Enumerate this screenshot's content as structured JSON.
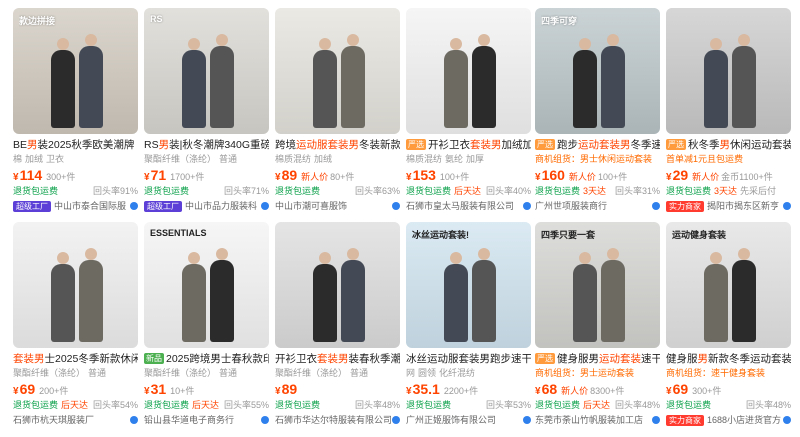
{
  "cards": [
    {
      "title_pre": "BE",
      "title_hl": "男",
      "title_post": "装2025秋季欧美潮牌",
      "tag": "",
      "attrs": [
        "棉",
        "加绒",
        "卫衣"
      ],
      "price": "114",
      "promo": "",
      "sales": "300+件",
      "services": [
        "退货包运费"
      ],
      "rate": "回头率91%",
      "shop_badge": "超级工厂",
      "shop": "中山市泰合国际服",
      "thumb_text": "款边拼接",
      "bg": "#cfc8bd"
    },
    {
      "title_pre": "RS",
      "title_hl": "男",
      "title_post": "装|秋冬潮牌340G重磅",
      "tag": "",
      "attrs": [
        "聚酯纤维（涤纶）",
        "普通"
      ],
      "price": "71",
      "promo": "",
      "sales": "1700+件",
      "services": [
        "退货包运费"
      ],
      "rate": "回头率71%",
      "shop_badge": "超级工厂",
      "shop": "中山市品力服装科",
      "thumb_text": "RS",
      "bg": "#d8d6d0"
    },
    {
      "title_pre": "跨境",
      "title_hl": "运动服套装男",
      "title_post": "冬装新款",
      "tag": "",
      "attrs": [
        "棉质混纺",
        "加绒"
      ],
      "price": "89",
      "promo": "新人价",
      "sales": "80+件",
      "services": [
        "退货包运费"
      ],
      "rate": "回头率63%",
      "shop_badge": "",
      "shop": "中山市潮可喜服饰",
      "thumb_text": "",
      "bg": "#e4e2db"
    },
    {
      "title_pre": "开衫卫衣",
      "title_hl": "套装男",
      "title_post": "加绒加",
      "tag": "严选",
      "attrs": [
        "棉质混纺",
        "氨纶",
        "加厚"
      ],
      "price": "153",
      "promo": "",
      "sales": "100+件",
      "services": [
        "退货包运费",
        "后天达"
      ],
      "rate": "回头率40%",
      "shop_badge": "",
      "shop": "石狮市皇太马服装有限公司",
      "thumb_text": "",
      "bg": "#f2f2f2"
    },
    {
      "title_pre": "跑步",
      "title_hl": "运动套装男",
      "title_post": "冬季速",
      "tag": "严选",
      "attrs_special": "商机组货：男士休闲运动套装",
      "attrs": [],
      "price": "160",
      "promo": "新人价",
      "sales": "100+件",
      "services": [
        "退货包运费",
        "3天达"
      ],
      "rate": "回头率31%",
      "shop_badge": "",
      "shop": "广州世项服装商行",
      "thumb_text": "四季可穿",
      "bg": "#b9c4c7"
    },
    {
      "title_pre": "秋冬季",
      "title_hl": "男",
      "title_post": "休闲运动套装青年",
      "tag": "严选",
      "attrs_special": "首单减1元且包运费",
      "attrs": [],
      "price": "29",
      "promo": "新人价",
      "sales": "金币1100+件",
      "services": [
        "退货包运费",
        "3天达",
        "先采后付"
      ],
      "rate": "",
      "shop_badge": "实力商家",
      "shop": "揭阳市揭东区新亨",
      "thumb_text": "",
      "bg": "#c9c9c9"
    },
    {
      "title_pre": "",
      "title_hl": "套装男",
      "title_post": "士2025冬季新款休闲",
      "tag": "",
      "attrs": [
        "聚酯纤维（涤纶）",
        "普通"
      ],
      "price": "69",
      "promo": "",
      "sales": "200+件",
      "services": [
        "退货包运费",
        "后天达"
      ],
      "rate": "回头率54%",
      "shop_badge": "",
      "shop": "石狮市杭天琪服装厂",
      "thumb_text": "",
      "bg": "#eeeeee"
    },
    {
      "title_pre": "2025跨境男士春秋款印",
      "title_hl": "",
      "title_post": "",
      "tag": "新品",
      "attrs": [
        "聚酯纤维（涤纶）",
        "普通"
      ],
      "price": "31",
      "promo": "",
      "sales": "10+件",
      "services": [
        "退货包运费",
        "后天达"
      ],
      "rate": "回头率55%",
      "shop_badge": "",
      "shop": "铅山县华道电子商务行",
      "thumb_text": "ESSENTIALS",
      "bg": "#f3f3f3"
    },
    {
      "title_pre": "开衫卫衣",
      "title_hl": "套装男",
      "title_post": "装春秋季潮",
      "tag": "",
      "attrs": [
        "聚酯纤维（涤纶）",
        "普通"
      ],
      "price": "89",
      "promo": "",
      "sales": "",
      "services": [
        "退货包运费"
      ],
      "rate": "回头率48%",
      "shop_badge": "",
      "shop": "石狮市华达尔特服装有限公司",
      "thumb_text": "",
      "bg": "#dcdcdc"
    },
    {
      "title_pre": "冰丝运动服套装男跑步速干",
      "title_hl": "",
      "title_post": "",
      "tag": "",
      "attrs": [
        "网",
        "圆领",
        "化纤混纺"
      ],
      "price": "35.1",
      "promo": "",
      "sales": "2200+件",
      "services": [
        "退货包运费"
      ],
      "rate": "回头率53%",
      "shop_badge": "",
      "shop": "广州正姬服饰有限公司",
      "thumb_text": "冰丝运动套装!",
      "bg": "#cfe3ef"
    },
    {
      "title_pre": "健身服男",
      "title_hl": "运动套装",
      "title_post": "速干",
      "tag": "严选",
      "attrs_special": "商机组货：男士运动套装",
      "attrs": [],
      "price": "68",
      "promo": "新人价",
      "sales": "8300+件",
      "services": [
        "退货包运费",
        "后天达"
      ],
      "rate": "回头率48%",
      "shop_badge": "",
      "shop": "东莞市荼山竹帆服装加工店",
      "thumb_text": "四季只要一套",
      "bg": "#d2d2cf"
    },
    {
      "title_pre": "健身服",
      "title_hl": "男",
      "title_post": "新款冬季运动套装",
      "tag": "",
      "attrs_special": "商机组货：速干健身套装",
      "attrs": [],
      "price": "69",
      "promo": "",
      "sales": "300+件",
      "services": [
        "退货包运费"
      ],
      "rate": "回头率48%",
      "shop_badge": "实力商家",
      "shop": "1688小店进货官方",
      "thumb_text": "运动健身套装",
      "bg": "#e1e1e1"
    }
  ]
}
